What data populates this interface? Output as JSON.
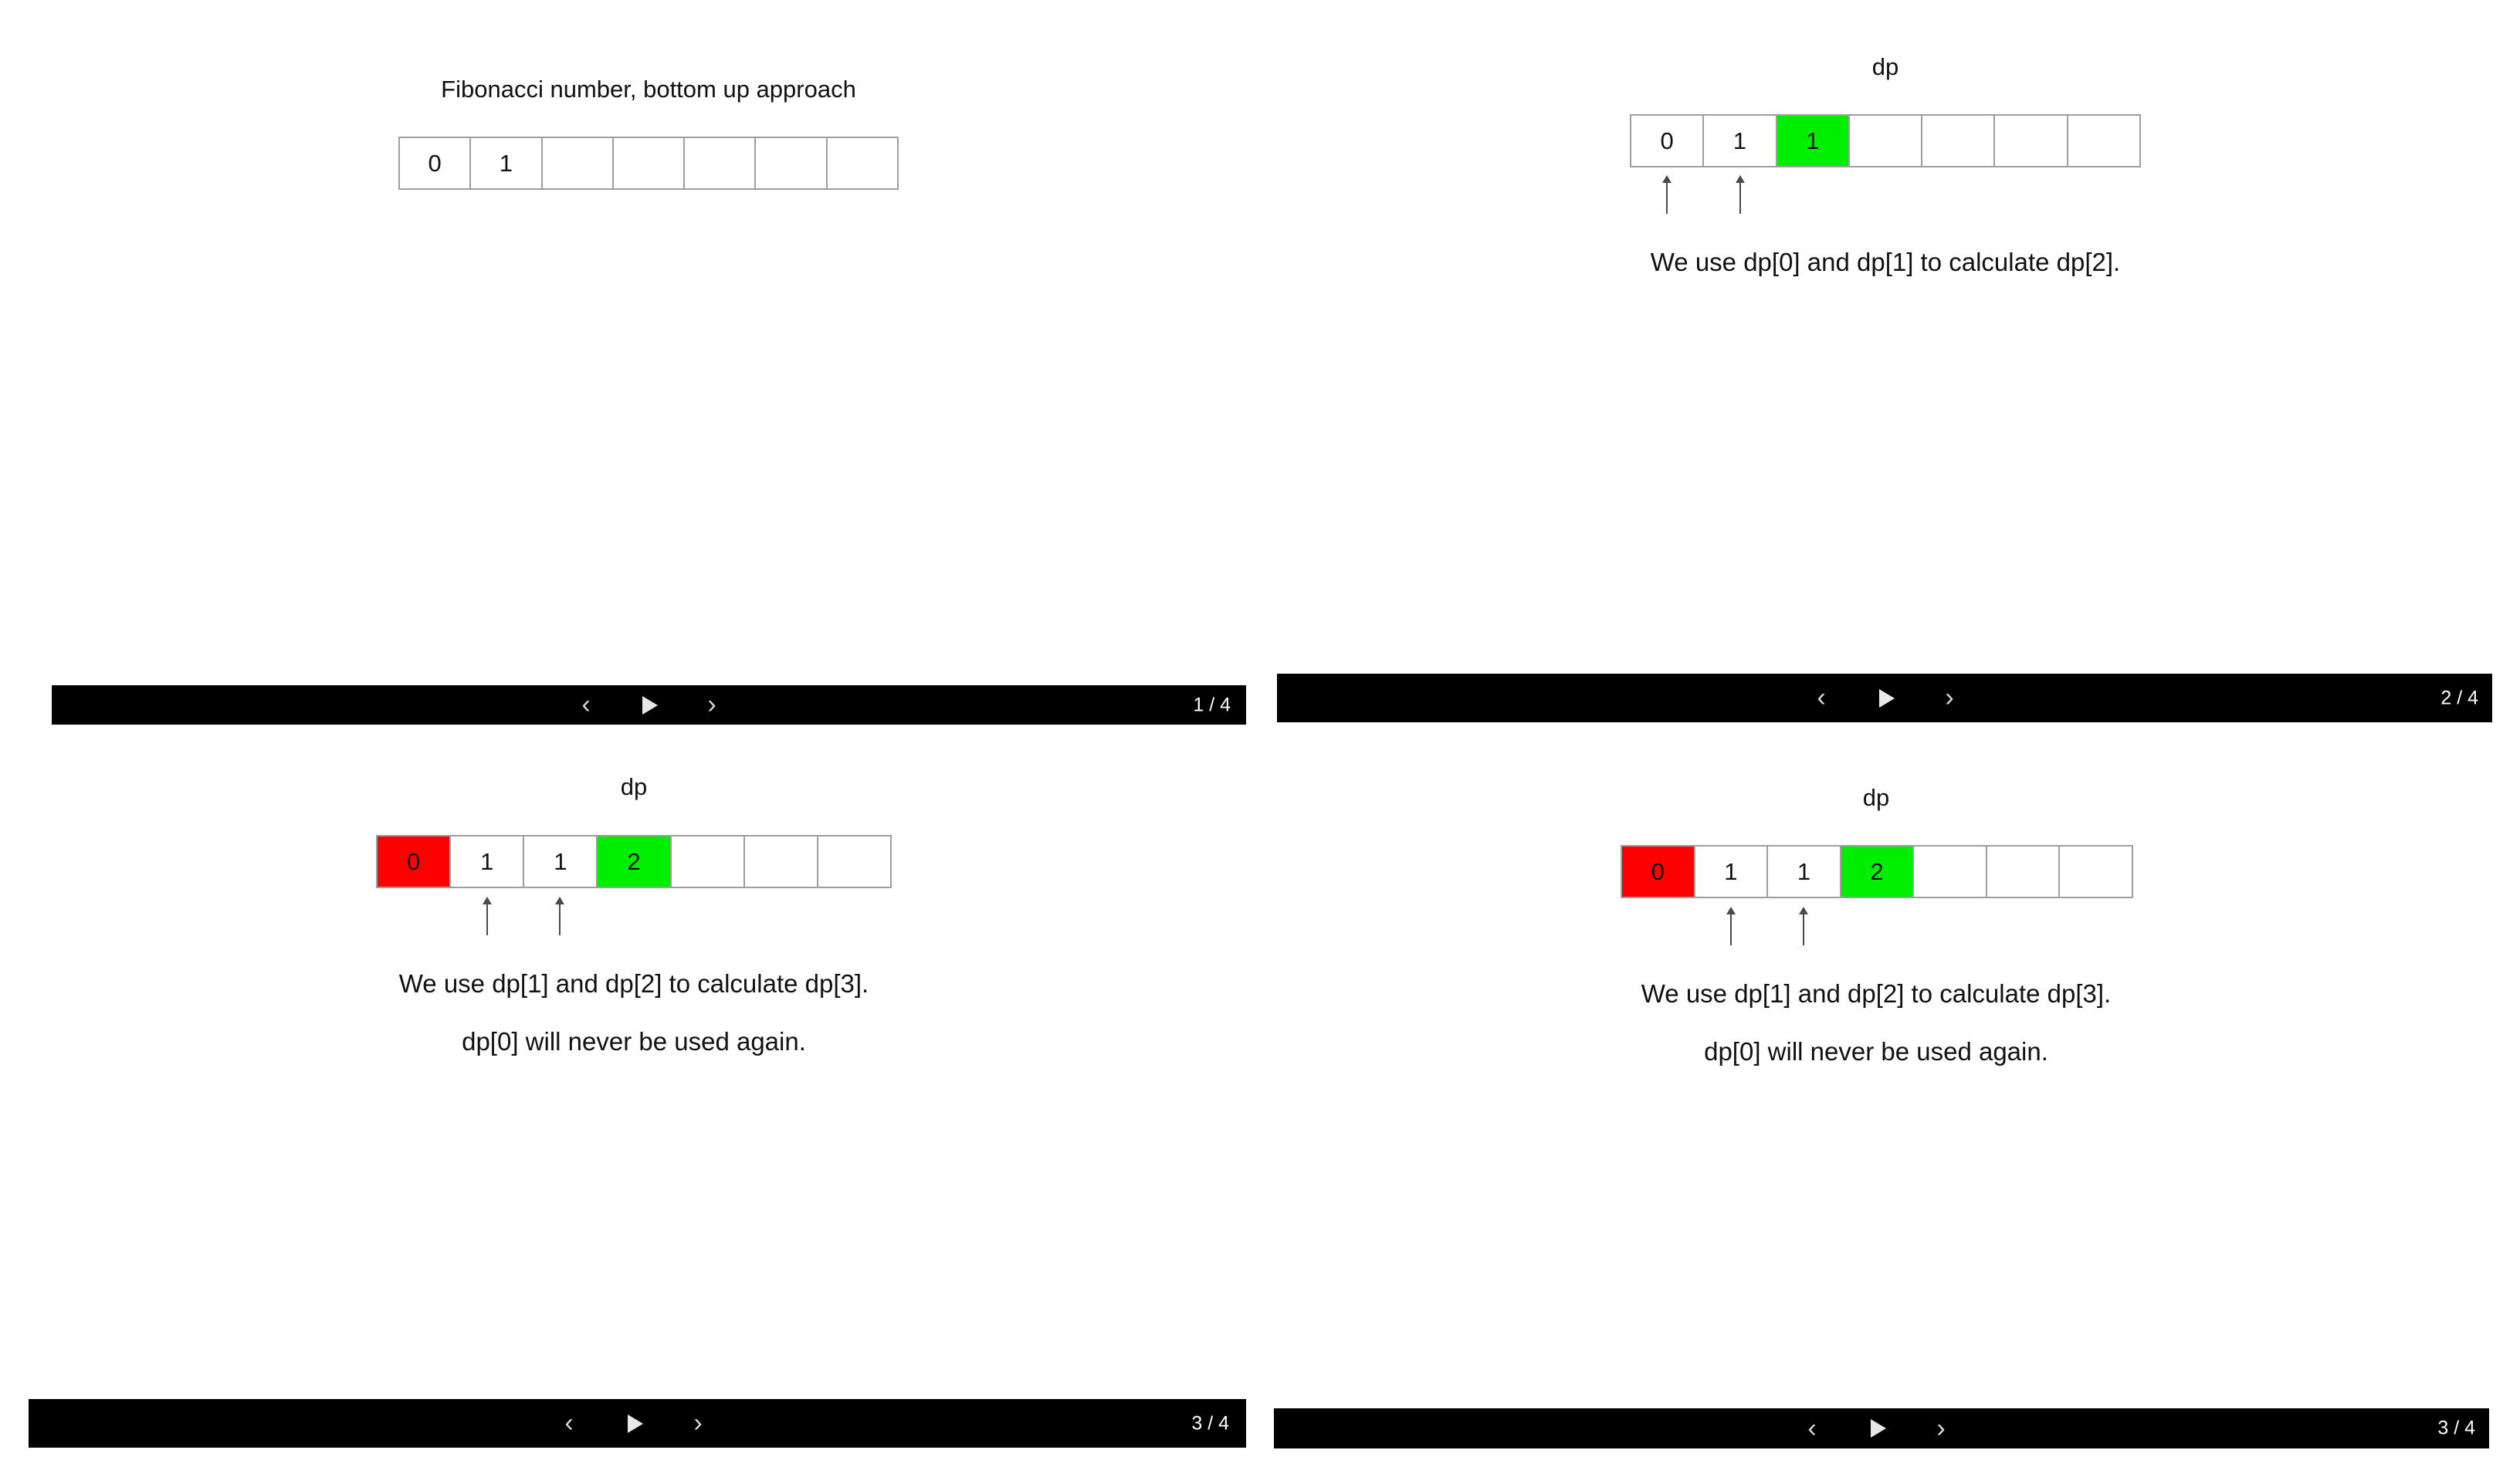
{
  "colors": {
    "bar": "#000000",
    "highlight_new": "#00ee00",
    "highlight_discarded": "#ff0000",
    "cell_border": "#9e9e9e"
  },
  "panels": [
    {
      "title": "Fibonacci number, bottom up approach",
      "cells": [
        {
          "value": "0",
          "state": "normal"
        },
        {
          "value": "1",
          "state": "normal"
        },
        {
          "value": "",
          "state": "normal"
        },
        {
          "value": "",
          "state": "normal"
        },
        {
          "value": "",
          "state": "normal"
        },
        {
          "value": "",
          "state": "normal"
        },
        {
          "value": "",
          "state": "normal"
        }
      ],
      "lines": [],
      "controls": {
        "prev_icon": "chevron-left-icon",
        "play_icon": "play-icon",
        "next_icon": "chevron-right-icon",
        "prev": "‹",
        "next": "›"
      },
      "counter": "1 / 4"
    },
    {
      "title": "dp",
      "cells": [
        {
          "value": "0",
          "state": "normal"
        },
        {
          "value": "1",
          "state": "normal"
        },
        {
          "value": "1",
          "state": "new"
        },
        {
          "value": "",
          "state": "normal"
        },
        {
          "value": "",
          "state": "normal"
        },
        {
          "value": "",
          "state": "normal"
        },
        {
          "value": "",
          "state": "normal"
        }
      ],
      "arrows_under_cells": [
        0,
        1
      ],
      "lines": [
        "We use dp[0] and dp[1] to calculate dp[2]."
      ],
      "controls": {
        "prev": "‹",
        "next": "›"
      },
      "counter": "2 / 4"
    },
    {
      "title": "dp",
      "cells": [
        {
          "value": "0",
          "state": "discarded"
        },
        {
          "value": "1",
          "state": "normal"
        },
        {
          "value": "1",
          "state": "normal"
        },
        {
          "value": "2",
          "state": "new"
        },
        {
          "value": "",
          "state": "normal"
        },
        {
          "value": "",
          "state": "normal"
        },
        {
          "value": "",
          "state": "normal"
        }
      ],
      "arrows_under_cells": [
        1,
        2
      ],
      "lines": [
        "We use dp[1] and dp[2] to calculate dp[3].",
        "dp[0] will never be used again."
      ],
      "controls": {
        "prev": "‹",
        "next": "›"
      },
      "counter": "3 / 4"
    },
    {
      "title": "dp",
      "cells": [
        {
          "value": "0",
          "state": "discarded"
        },
        {
          "value": "1",
          "state": "normal"
        },
        {
          "value": "1",
          "state": "normal"
        },
        {
          "value": "2",
          "state": "new"
        },
        {
          "value": "",
          "state": "normal"
        },
        {
          "value": "",
          "state": "normal"
        },
        {
          "value": "",
          "state": "normal"
        }
      ],
      "arrows_under_cells": [
        1,
        2
      ],
      "lines": [
        "We use dp[1] and dp[2] to calculate dp[3].",
        "dp[0] will never be used again."
      ],
      "controls": {
        "prev": "‹",
        "next": "›"
      },
      "counter": "3 / 4"
    }
  ]
}
